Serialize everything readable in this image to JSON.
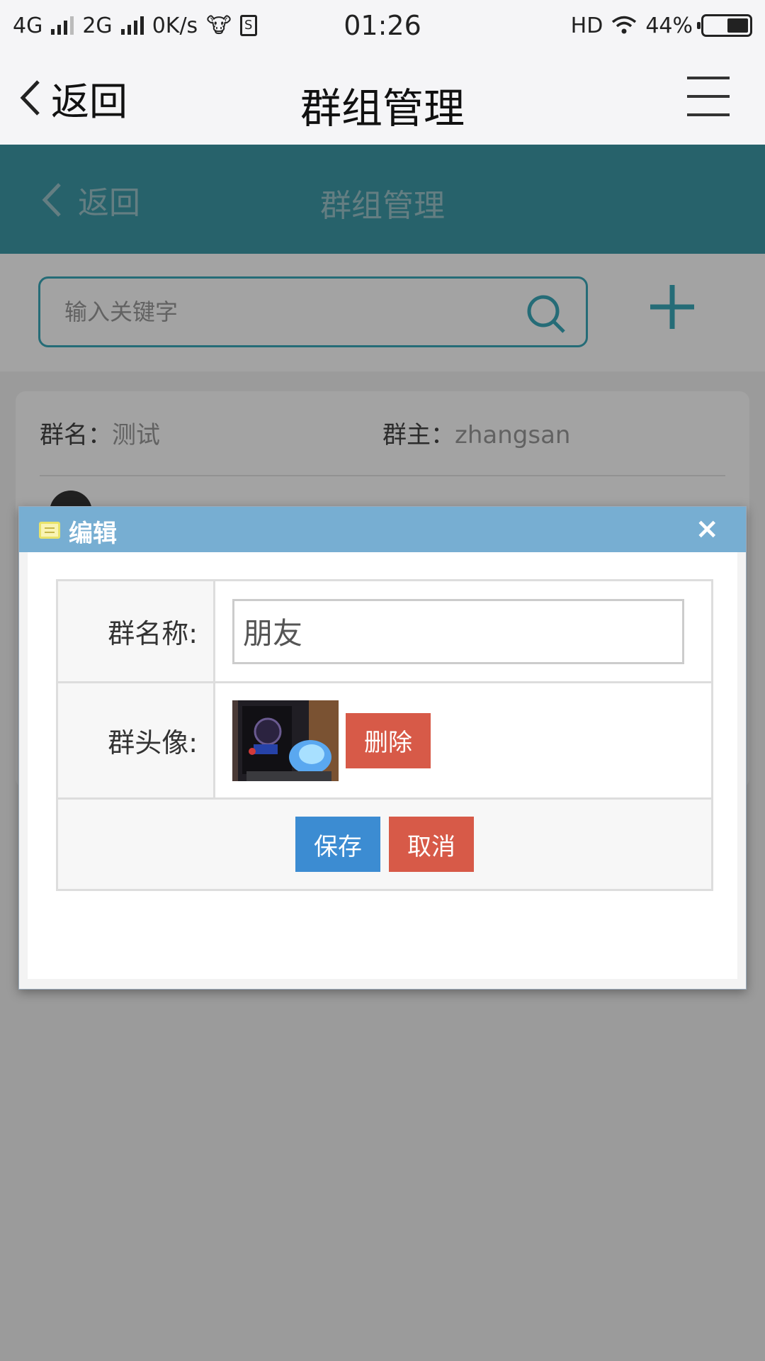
{
  "status_bar": {
    "network1": "4G",
    "network2": "2G",
    "speed": "0K/s",
    "time": "01:26",
    "hd": "HD",
    "battery": "44%",
    "battery_level": 0.44
  },
  "navbar": {
    "back_label": "返回",
    "title": "群组管理"
  },
  "web_header": {
    "back_label": "返回",
    "title": "群组管理"
  },
  "search": {
    "placeholder": "输入关键字"
  },
  "card": {
    "name_label": "群名：",
    "name_value": "测试",
    "owner_label": "群主：",
    "owner_value": "zhangsan"
  },
  "dialog": {
    "title": "编辑",
    "close": "×",
    "name_label": "群名称:",
    "name_value": "朋友",
    "avatar_label": "群头像:",
    "delete_label": "删除",
    "save_label": "保存",
    "cancel_label": "取消"
  },
  "colors": {
    "header": "#3d9aa8",
    "accent": "#3aa9ba",
    "dialog_head": "#77aed2",
    "save": "#3c8cd2",
    "danger": "#d75a48"
  }
}
